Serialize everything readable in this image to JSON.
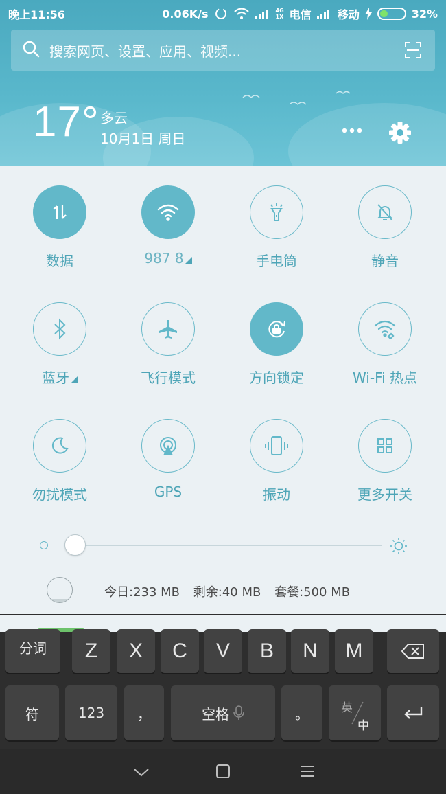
{
  "status_bar": {
    "time": "晚上11:56",
    "speed": "0.06K/s",
    "network_tag_top": "4G",
    "network_tag_bottom": "1X",
    "carrier1": "电信",
    "carrier2": "移动",
    "battery": "32%",
    "battery_level": 0.32
  },
  "search": {
    "placeholder": "搜索网页、设置、应用、视频..."
  },
  "weather": {
    "temperature": "17°",
    "condition": "多云",
    "date": "10月1日 周日"
  },
  "tiles": [
    {
      "label": "数据",
      "icon": "data-arrows-icon",
      "active": true
    },
    {
      "label": "987  8",
      "icon": "wifi-icon",
      "active": true
    },
    {
      "label": "手电筒",
      "icon": "flashlight-icon",
      "active": false
    },
    {
      "label": "静音",
      "icon": "bell-off-icon",
      "active": false
    },
    {
      "label": "蓝牙",
      "icon": "bluetooth-icon",
      "active": false
    },
    {
      "label": "飞行模式",
      "icon": "airplane-icon",
      "active": false
    },
    {
      "label": "方向锁定",
      "icon": "rotation-lock-icon",
      "active": true
    },
    {
      "label": "Wi-Fi 热点",
      "icon": "hotspot-icon",
      "active": false
    },
    {
      "label": "勿扰模式",
      "icon": "moon-icon",
      "active": false
    },
    {
      "label": "GPS",
      "icon": "gps-icon",
      "active": false
    },
    {
      "label": "振动",
      "icon": "vibrate-icon",
      "active": false
    },
    {
      "label": "更多开关",
      "icon": "grid-icon",
      "active": false
    }
  ],
  "brightness": {
    "level": 0.03
  },
  "data_usage": {
    "today": "今日:233 MB",
    "remaining": "剩余:40 MB",
    "plan": "套餐:500 MB"
  },
  "keyboard": {
    "row1": [
      "分词",
      "Z",
      "X",
      "C",
      "V",
      "B",
      "N",
      "M"
    ],
    "row2": {
      "symbol": "符",
      "numbers": "123",
      "comma": "，",
      "space": "空格",
      "period": "。",
      "lang_top": "英",
      "lang_bottom": "中"
    }
  }
}
